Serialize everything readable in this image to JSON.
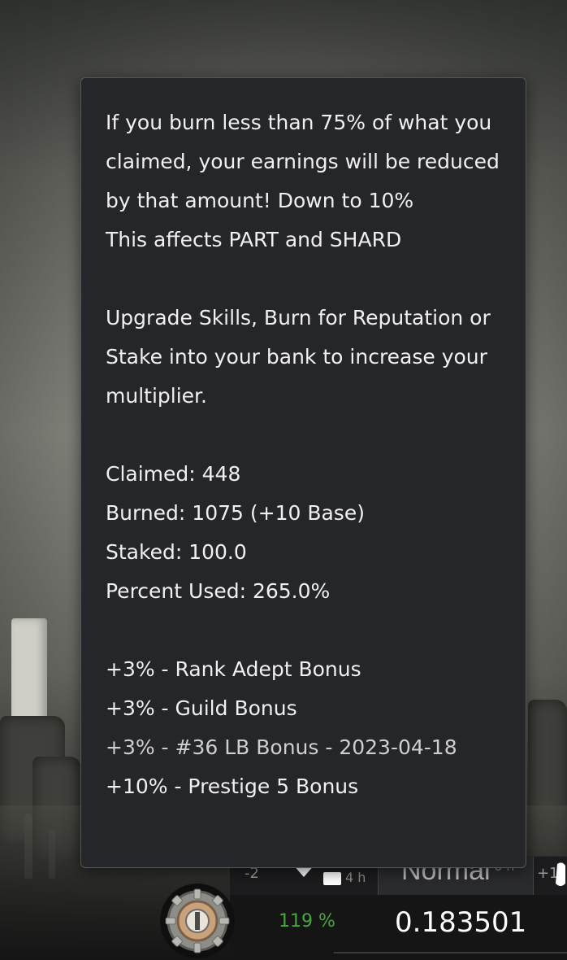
{
  "tooltip": {
    "paragraph1": "If you burn less than 75% of what you claimed, your earnings will be reduced by that amount! Down to 10%",
    "affects": "This affects PART and SHARD",
    "paragraph2": "Upgrade Skills, Burn for Reputation or Stake into your bank to increase your multiplier.",
    "stats": [
      "Claimed: 448",
      "Burned: 1075 (+10 Base)",
      "Staked: 100.0",
      "Percent Used: 265.0%"
    ],
    "bonuses": [
      "+3% - Rank Adept Bonus",
      "+3% - Guild Bonus",
      "+3% - #36 LB Bonus - 2023-04-18",
      "+10% - Prestige 5 Bonus"
    ]
  },
  "hud": {
    "left_mini": "-2",
    "time_left": "4 h",
    "mode_label": "Normal",
    "mode_time": "6 h",
    "right_mini": "+1",
    "percent": "119 %",
    "amount": "0.183501"
  },
  "colors": {
    "tooltip_bg": "#25262a",
    "percent_green": "#47a63d",
    "amount_white": "#ffffff"
  },
  "icons": [
    "gear-emblem-icon",
    "chevron-down-icon",
    "card-icon",
    "hand-icon"
  ]
}
